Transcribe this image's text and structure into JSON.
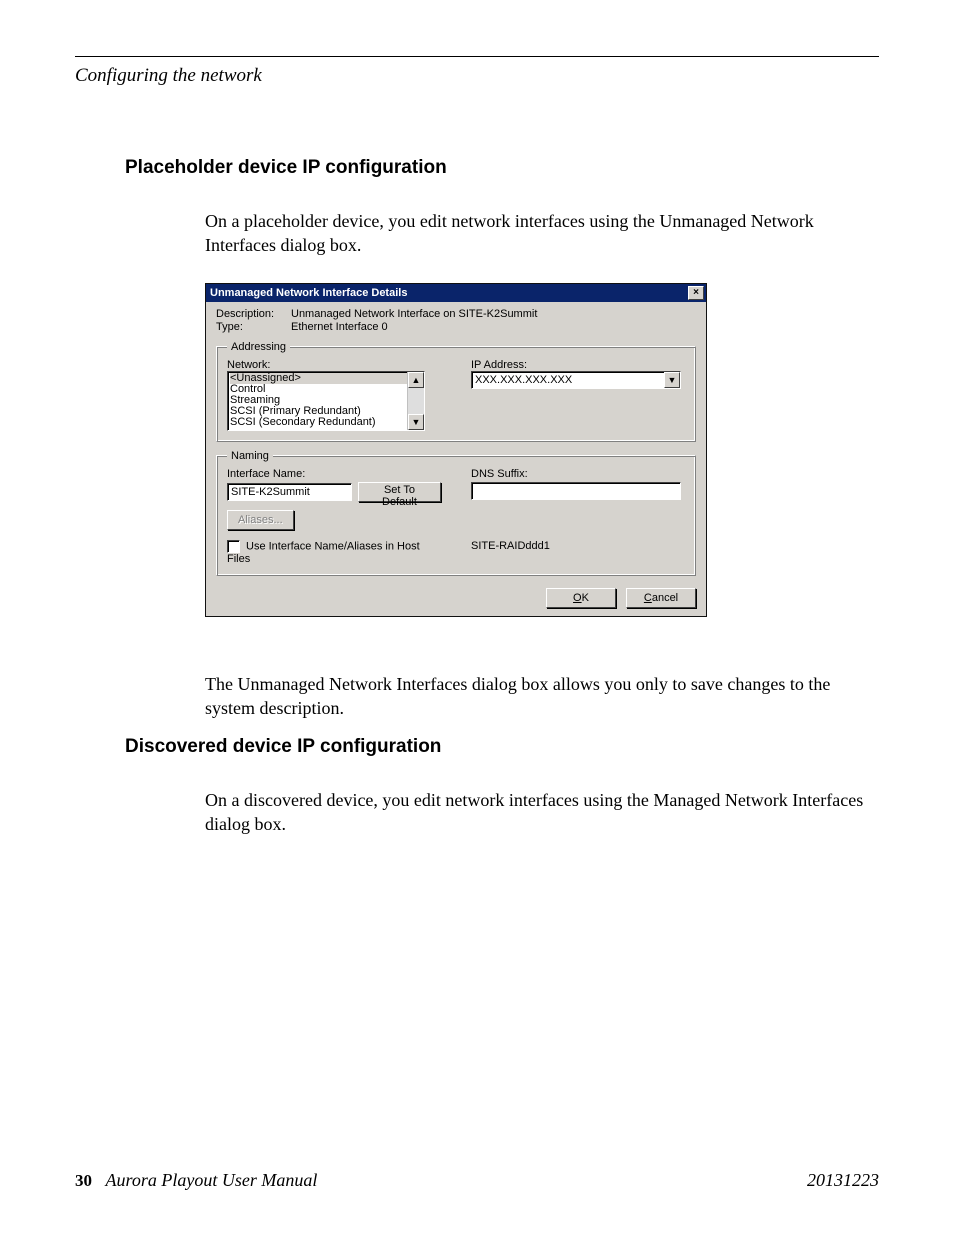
{
  "header": {
    "running": "Configuring the network"
  },
  "section1": {
    "heading": "Placeholder device IP configuration",
    "intro": "On a placeholder device, you edit network interfaces using the Unmanaged Network Interfaces dialog box.",
    "outro": "The Unmanaged Network Interfaces dialog box allows you only to save changes to the system description."
  },
  "dialog": {
    "title": "Unmanaged Network Interface Details",
    "description_label": "Description:",
    "description_value": "Unmanaged Network Interface on SITE-K2Summit",
    "type_label": "Type:",
    "type_value": "Ethernet Interface 0",
    "addressing": {
      "legend": "Addressing",
      "network_label": "Network:",
      "network_options": [
        "<Unassigned>",
        "Control",
        "Streaming",
        "SCSI (Primary Redundant)",
        "SCSI (Secondary Redundant)"
      ],
      "ip_label": "IP Address:",
      "ip_value": "XXX.XXX.XXX.XXX"
    },
    "naming": {
      "legend": "Naming",
      "iface_name_label": "Interface Name:",
      "iface_name_value": "SITE-K2Summit",
      "set_default_label": "Set To Default",
      "dns_label": "DNS Suffix:",
      "dns_value": "",
      "aliases_label": "Aliases...",
      "hostfiles_checkbox_label": "Use Interface Name/Aliases in Host Files",
      "hostfiles_checked": false,
      "right_text": "SITE-RAIDddd1"
    },
    "buttons": {
      "ok": "OK",
      "ok_accel": "O",
      "cancel": "Cancel",
      "cancel_accel": "C"
    }
  },
  "section2": {
    "heading": "Discovered device IP configuration",
    "intro": "On a discovered device, you edit network interfaces using the Managed Network Interfaces dialog box."
  },
  "footer": {
    "page": "30",
    "manual": "Aurora Playout   User Manual",
    "date": "20131223"
  }
}
